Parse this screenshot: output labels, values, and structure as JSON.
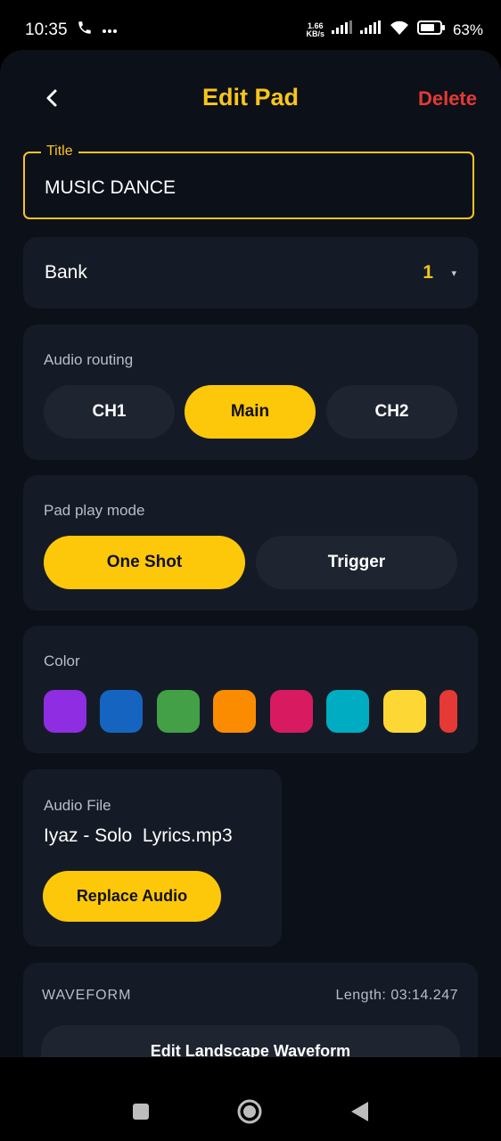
{
  "status_bar": {
    "time": "10:35",
    "net_speed_value": "1.66",
    "net_speed_unit": "KB/s",
    "battery_percent": "63%",
    "icons": [
      "phone-icon",
      "more-dots-icon",
      "signal-icon",
      "wifi-icon",
      "battery-icon"
    ]
  },
  "header": {
    "title": "Edit Pad",
    "delete_label": "Delete",
    "back_icon": "chevron-left-icon"
  },
  "title_field": {
    "label": "Title",
    "value": "MUSIC DANCE"
  },
  "bank": {
    "label": "Bank",
    "value": "1",
    "caret": "▾"
  },
  "audio_routing": {
    "label": "Audio routing",
    "options": [
      "CH1",
      "Main",
      "CH2"
    ],
    "selected": "Main"
  },
  "play_mode": {
    "label": "Pad play mode",
    "options": [
      "One Shot",
      "Trigger"
    ],
    "selected": "One Shot"
  },
  "color": {
    "label": "Color",
    "swatches": [
      "#8e2de2",
      "#1565c0",
      "#43a047",
      "#fb8c00",
      "#d81b60",
      "#00acc1",
      "#fdd835",
      "#e53935"
    ]
  },
  "audio_file": {
    "label": "Audio File",
    "filename": "Iyaz - Solo  Lyrics.mp3",
    "replace_label": "Replace Audio"
  },
  "waveform": {
    "label": "WAVEFORM",
    "length_text": "Length: 03:14.247",
    "edit_label": "Edit Landscape Waveform"
  },
  "colors": {
    "accent": "#fec80a",
    "danger": "#e53935",
    "background": "#0c1018",
    "card": "#151b26",
    "pill_inactive": "#1e2430"
  }
}
